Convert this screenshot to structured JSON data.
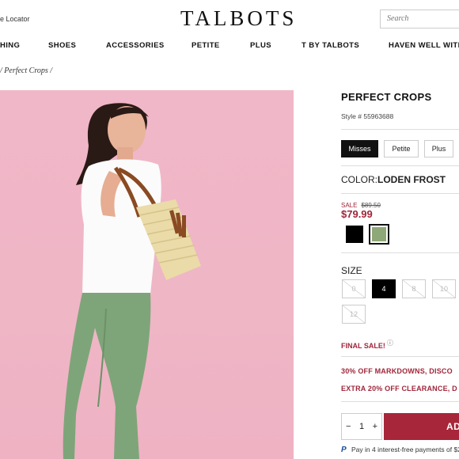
{
  "header": {
    "store_locator": "e Locator",
    "logo": "TALBOTS",
    "search_placeholder": "Search"
  },
  "nav": {
    "items": [
      "HING",
      "SHOES",
      "ACCESSORIES",
      "PETITE",
      "PLUS",
      "T BY TALBOTS",
      "HAVEN WELL WITH"
    ]
  },
  "breadcrumb": "/ Perfect Crops /",
  "product": {
    "title": "PERFECT CROPS",
    "style_number": "Style # 55963688",
    "size_types": [
      "Misses",
      "Petite",
      "Plus"
    ],
    "size_type_selected": "Misses",
    "color_label": "COLOR:",
    "color_value": "LODEN FROST",
    "sale_label": "SALE",
    "original_price": "$89.50",
    "sale_price": "$79.99",
    "swatches": [
      {
        "name": "black",
        "color": "#000000"
      },
      {
        "name": "loden frost",
        "color": "#8fa877",
        "selected": true
      }
    ],
    "size_label": "SIZE",
    "sizes": [
      "0",
      "4",
      "8",
      "10",
      "12"
    ],
    "size_selected": "4",
    "final_sale": "FINAL SALE!",
    "promos": [
      "30% OFF MARKDOWNS, DISCO",
      "EXTRA 20% OFF CLEARANCE, D"
    ],
    "quantity": "1",
    "qty_minus": "−",
    "qty_plus": "+",
    "add_button": "AD",
    "paypal_text": "Pay in 4 interest-free payments of $2"
  },
  "colors": {
    "accent": "#a8263a",
    "photo_background": "#efb6c6"
  }
}
